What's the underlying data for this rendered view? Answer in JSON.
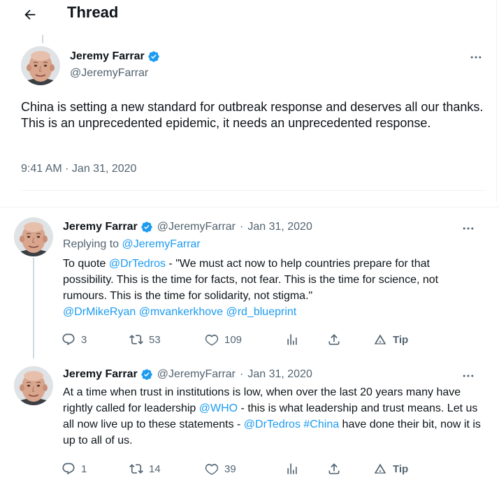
{
  "header": {
    "title": "Thread"
  },
  "icons": {
    "back": "arrow-left-icon",
    "more": "more-horizontal-icon",
    "verified": "verified-badge-icon",
    "reply": "reply-icon",
    "retweet": "retweet-icon",
    "like": "heart-icon",
    "views": "analytics-icon",
    "share": "share-icon",
    "tip": "tip-icon"
  },
  "colors": {
    "link": "#1d9bf0",
    "secondary_text": "#536471",
    "primary_text": "#0f1419",
    "verified": "#1d9bf0"
  },
  "main_tweet": {
    "author_name": "Jeremy Farrar",
    "handle": "@JeremyFarrar",
    "text": "China is setting a new standard for outbreak response and deserves all our thanks.  This is an unprecedented epidemic, it needs an unprecedented response.",
    "timestamp": "9:41 AM · Jan 31, 2020"
  },
  "replies": [
    {
      "author_name": "Jeremy Farrar",
      "handle": "@JeremyFarrar",
      "separator": "·",
      "date": "Jan 31, 2020",
      "replying_prefix": "Replying to ",
      "replying_to": "@JeremyFarrar",
      "text_parts": {
        "p1": "To quote ",
        "m1": "@DrTedros",
        "p2": " - \"We must act now to help countries prepare for that possibility. This is the time for facts, not fear. This is the time for science, not rumours. This is the time for solidarity, not stigma.\"",
        "m2": "@DrMikeRyan",
        "m3": "@mvankerkhove",
        "m4": "@rd_blueprint"
      },
      "stats": {
        "replies": "3",
        "retweets": "53",
        "likes": "109",
        "tip": "Tip"
      }
    },
    {
      "author_name": "Jeremy Farrar",
      "handle": "@JeremyFarrar",
      "separator": "·",
      "date": "Jan 31, 2020",
      "text_parts": {
        "p1": "At a time when trust in institutions is low, when over the last 20 years many have rightly called for leadership ",
        "m1": "@WHO",
        "p2": " - this is what leadership and trust means. Let us all now live up to these statements - ",
        "m2": "@DrTedros",
        "m3": "#China",
        "p3": " have done their bit, now it is up to all of us."
      },
      "stats": {
        "replies": "1",
        "retweets": "14",
        "likes": "39",
        "tip": "Tip"
      }
    }
  ]
}
